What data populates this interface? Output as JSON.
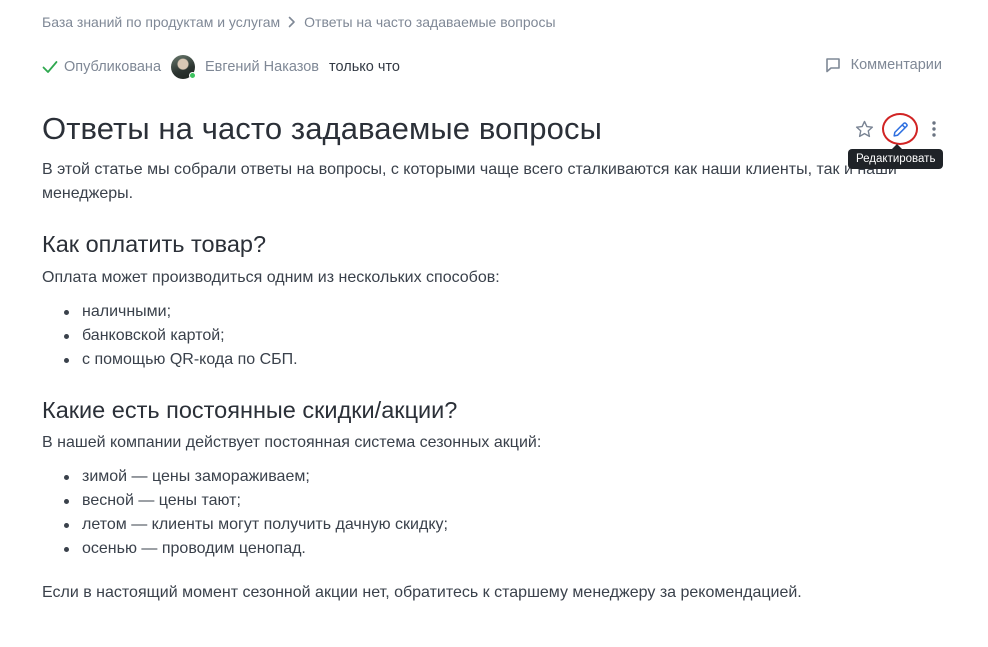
{
  "breadcrumb": {
    "items": [
      {
        "label": "База знаний по продуктам и услугам"
      },
      {
        "label": "Ответы на часто задаваемые вопросы"
      }
    ]
  },
  "meta": {
    "status": "Опубликована",
    "author": "Евгений Наказов",
    "time": "только что",
    "comments_label": "Комментарии"
  },
  "article": {
    "title": "Ответы на часто задаваемые вопросы",
    "intro": "В этой статье мы собрали ответы на вопросы, с которыми чаще всего сталкиваются как наши клиенты, так и наши менеджеры.",
    "sections": [
      {
        "heading": "Как оплатить товар?",
        "lead": "Оплата может производиться одним из нескольких способов:",
        "items": [
          "наличными;",
          "банковской картой;",
          "с помощью QR-кода по СБП."
        ]
      },
      {
        "heading": "Какие есть постоянные скидки/акции?",
        "lead": "В нашей компании действует постоянная система сезонных акций:",
        "items": [
          "зимой — цены замораживаем;",
          "весной — цены тают;",
          "летом — клиенты могут получить дачную скидку;",
          "осенью — проводим ценопад."
        ]
      }
    ],
    "outro": "Если в настоящий момент сезонной акции нет, обратитесь к старшему менеджеру за рекомендацией."
  },
  "actions": {
    "edit_tooltip": "Редактировать",
    "icons": [
      "star-icon",
      "pencil-icon",
      "more-vertical-icon"
    ]
  },
  "colors": {
    "accent": "#2d6fe0",
    "status_check": "#2fa84f",
    "highlight_ring": "#d12424",
    "muted_text": "#7f8896"
  }
}
